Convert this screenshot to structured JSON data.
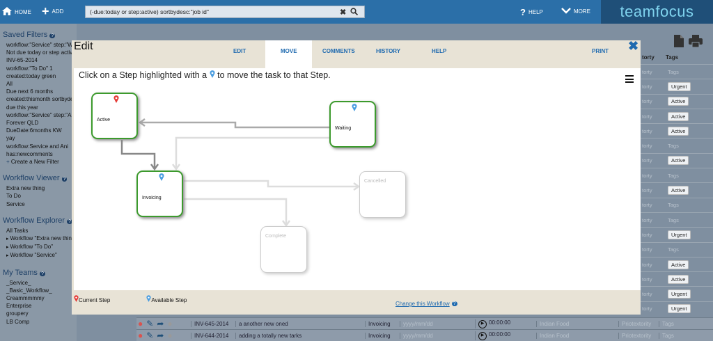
{
  "topbar": {
    "home": "HOME",
    "add": "ADD",
    "search_value": "(-due:today or step:active) sortbydesc:\"job id\"",
    "help": "HELP",
    "more": "MORE",
    "logo": "teamfocus"
  },
  "sidebar": {
    "saved_filters_title": "Saved Filters",
    "saved_filters": [
      "workflow:\"Service\" step:\"Waiting\"",
      "Not due today or step active",
      "INV-65-2014",
      "workflow:\"To Do\" 1",
      "created:today green",
      "All",
      "Due next 6 months",
      "created:thismonth sortbydesc",
      "due this year",
      "workflow:\"Service\" step:\"A",
      "Forever QLD",
      "DueDate:6months KW",
      "yay",
      "workflow:Service and Ani",
      "has:newcomments"
    ],
    "create_filter": "Create a New Filter",
    "viewer_title": "Workflow Viewer",
    "viewer_items": [
      "Extra new thing",
      "To Do",
      "Service"
    ],
    "explorer_title": "Workflow Explorer",
    "explorer_items": [
      "All Tasks",
      "Workflow \"Extra new thing\"",
      "Workflow \"To Do\"",
      "Workflow \"Service\""
    ],
    "teams_title": "My Teams",
    "teams": [
      "_Service_",
      "_Basic_Workflow_",
      "Creammmmmy",
      "Enterprise",
      "groupery",
      "LB Comp"
    ]
  },
  "right": {
    "col1": "torty",
    "col2": "Tags",
    "cells": [
      "torty",
      "torty",
      "torty",
      "torty",
      "torty",
      "torty",
      "torty",
      "torty",
      "torty",
      "torty",
      "torty",
      "torty",
      "torty",
      "torty",
      "torty",
      "torty",
      "torty"
    ],
    "tags": [
      "Tags",
      "Urgent",
      "Active",
      "Active",
      "Active",
      "Tags",
      "Active",
      "Tags",
      "Active",
      "Tags",
      "Tags",
      "Urgent",
      "Tags",
      "Active",
      "Active",
      "Urgent",
      "Urgent"
    ]
  },
  "bg_rows": [
    {
      "id": "INV-645-2014",
      "name": "a another new oned",
      "step": "Invoicing",
      "date": "yyyy/mm/dd",
      "time": "00:00:00",
      "food": "Indian Food",
      "prio": "Priotextority",
      "tags": "Tags"
    },
    {
      "id": "INV-644-2014",
      "name": "adding a totally new tarks",
      "step": "Invoicing",
      "date": "yyyy/mm/dd",
      "time": "00:00:00",
      "food": "Indian Food",
      "prio": "Priotextority",
      "tags": "Tags"
    }
  ],
  "dialog": {
    "title": "Edit",
    "tabs": [
      "EDIT",
      "MOVE",
      "COMMENTS",
      "HISTORY",
      "HELP",
      "PRINT"
    ],
    "instruction_pre": "Click on a Step highlighted with a",
    "instruction_post": "to move the task to that Step.",
    "steps": [
      {
        "name": "Active",
        "state": "current"
      },
      {
        "name": "Waiting",
        "state": "available"
      },
      {
        "name": "Invoicing",
        "state": "available"
      },
      {
        "name": "Cancelled",
        "state": "unavailable"
      },
      {
        "name": "Complete",
        "state": "unavailable"
      }
    ],
    "legend_current": "Current Step",
    "legend_available": "Available Step",
    "change_workflow": "Change this Workflow"
  },
  "colors": {
    "brand": "#2b6fa8",
    "current_pin": "#e53935",
    "available_pin": "#4a9de0",
    "step_border": "#3c9a2d"
  }
}
